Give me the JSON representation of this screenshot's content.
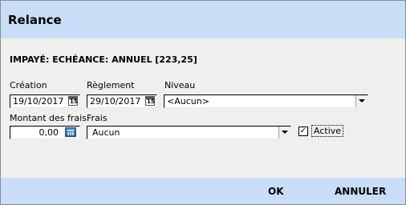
{
  "window": {
    "title": "Relance"
  },
  "heading": "IMPAYÉ: ECHÉANCE: ANNUEL [223,25]",
  "creation": {
    "label": "Création",
    "value": "19/10/2017",
    "calendar_glyph": "15"
  },
  "reglement": {
    "label": "Règlement",
    "value": "29/10/2017",
    "calendar_glyph": "15"
  },
  "niveau": {
    "label": "Niveau",
    "value": "<Aucun>"
  },
  "montant": {
    "label": "Montant des frais",
    "value": "0,00"
  },
  "frais": {
    "label": "Frais",
    "value": "Aucun"
  },
  "active": {
    "label": "Active",
    "checked": true,
    "check_glyph": "✓"
  },
  "buttons": {
    "ok": "OK",
    "cancel": "ANNULER"
  },
  "colors": {
    "title_bar": "#c9ddf7",
    "footer_bar": "#c9ddf7",
    "body": "#efefef"
  }
}
